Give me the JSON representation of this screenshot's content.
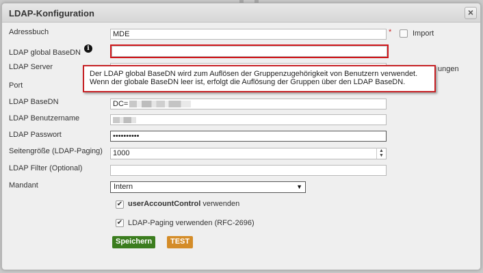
{
  "dialog": {
    "title": "LDAP-Konfiguration",
    "close_label": "×"
  },
  "form": {
    "adressbuch_label": "Adressbuch",
    "adressbuch_value": "MDE",
    "required_mark": "*",
    "import_label": "Import",
    "global_basedn_label": "LDAP global BaseDN",
    "global_basedn_value": "",
    "info_glyph": "i",
    "server_label": "LDAP Server",
    "server_suffix_text": "ungen",
    "port_label": "Port",
    "basedn_label": "LDAP BaseDN",
    "basedn_value": "DC=",
    "benutzername_label": "LDAP Benutzername",
    "passwort_label": "LDAP Passwort",
    "passwort_value": "••••••••••",
    "seitengroesse_label": "Seitengröße (LDAP-Paging)",
    "seitengroesse_value": "1000",
    "filter_label": "LDAP Filter (Optional)",
    "filter_value": "",
    "mandant_label": "Mandant",
    "mandant_value": "Intern",
    "uac_bold": "userAccountControl",
    "uac_rest": " verwenden",
    "uac_checked": true,
    "paging_label": "LDAP-Paging verwenden (RFC-2696)",
    "paging_checked": true,
    "check_glyph": "✔"
  },
  "buttons": {
    "save_label": "Speichern",
    "test_label": "TEST"
  },
  "tooltip": {
    "line1": "Der LDAP global BaseDN wird zum Auflösen der Gruppenzugehörigkeit von Benutzern verwendet.",
    "line2": "Wenn der globale BaseDN leer ist, erfolgt die Auflösung der Gruppen über den LDAP BaseDN."
  },
  "colors": {
    "save": "#3b7d1e",
    "test": "#d48c28",
    "highlight": "#d0161a"
  }
}
